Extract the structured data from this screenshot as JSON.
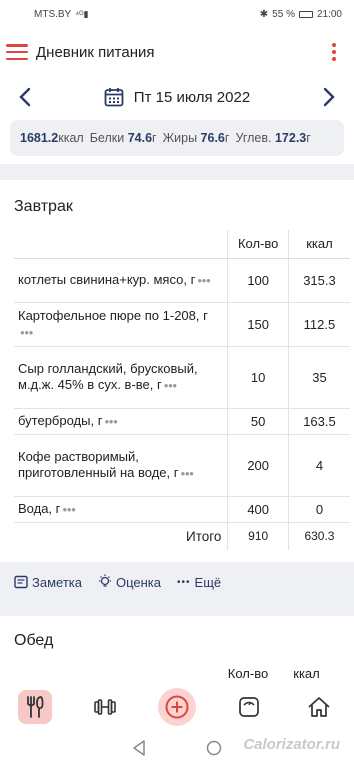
{
  "statusbar": {
    "carrier": "MTS.BY",
    "battery": "55 %",
    "time": "21:00"
  },
  "appbar": {
    "title": "Дневник питания"
  },
  "date": {
    "label": "Пт 15 июля 2022"
  },
  "summary": {
    "kcal_value": "1681.2",
    "kcal_unit": "ккал",
    "protein_label": "Белки",
    "protein_value": "74.6",
    "protein_unit": "г",
    "fat_label": "Жиры",
    "fat_value": "76.6",
    "fat_unit": "г",
    "carb_label": "Углев.",
    "carb_value": "172.3",
    "carb_unit": "г"
  },
  "breakfast": {
    "title": "Завтрак",
    "headers": {
      "qty": "Кол-во",
      "kcal": "ккал"
    },
    "rows": [
      {
        "name": "котлеты свинина+кур. мясо, г",
        "qty": "100",
        "kcal": "315.3"
      },
      {
        "name": "Картофельное пюре по 1-208, г",
        "qty": "150",
        "kcal": "112.5"
      },
      {
        "name": "Сыр голландский, брусковый, м.д.ж. 45% в сух. в-ве, г",
        "qty": "10",
        "kcal": "35"
      },
      {
        "name": "бутерброды, г",
        "qty": "50",
        "kcal": "163.5"
      },
      {
        "name": "Кофе растворимый, приготовленный на воде, г",
        "qty": "200",
        "kcal": "4"
      },
      {
        "name": "Вода, г",
        "qty": "400",
        "kcal": "0"
      }
    ],
    "total": {
      "label": "Итого",
      "qty": "910",
      "kcal": "630.3"
    }
  },
  "actions": {
    "note": "Заметка",
    "rating": "Оценка",
    "more": "Ещё"
  },
  "lunch": {
    "title": "Обед",
    "headers": {
      "qty": "Кол-во",
      "kcal": "ккал"
    }
  },
  "watermark": "Calorizator.ru"
}
